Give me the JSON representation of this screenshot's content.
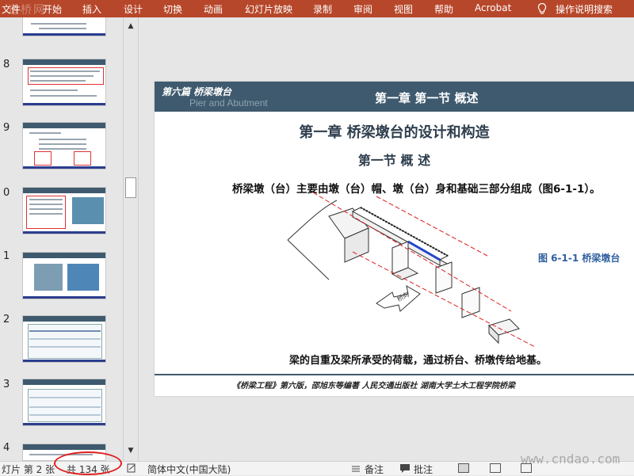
{
  "ribbon": {
    "watermark": "道桥网",
    "tabs": [
      "文件",
      "开始",
      "插入",
      "设计",
      "切换",
      "动画",
      "幻灯片放映",
      "录制",
      "审阅",
      "视图",
      "帮助",
      "Acrobat",
      "操作说明搜索"
    ]
  },
  "thumbnails": {
    "numbers": [
      "8",
      "9",
      "0",
      "1",
      "2",
      "3",
      "4"
    ]
  },
  "slide": {
    "part_title": "第六篇 桥梁墩台",
    "part_subtitle": "Pier and Abutment",
    "chapter_header": "第一章 第一节  概述",
    "main_title": "第一章  桥梁墩台的设计和构造",
    "sub_title": "第一节 概 述",
    "intro_text": "桥梁墩（台）主要由墩（台）帽、墩（台）身和基础三部分组成（图6-1-1）。",
    "figure_caption": "图 6-1-1 桥梁墩台",
    "diagram_label": "桥向",
    "bottom_text": "梁的自重及梁所承受的荷载，通过桥台、桥墩传给地基。",
    "footer": "《桥梁工程》第六版，邵旭东等编著      人民交通出版社      湖南大学土木工程学院桥梁"
  },
  "statusbar": {
    "slide_info_a": "灯片 第 2 张",
    "slide_info_b": "共 134 张",
    "language": "简体中文(中国大陆)",
    "notes_label": "备注",
    "comments_label": "批注",
    "watermark": "www.cndao.com"
  },
  "colors": {
    "ribbon": "#b7472a",
    "slide_header": "#3f5a6e",
    "caption_blue": "#2f5f9e",
    "annotation_red": "#e02020"
  }
}
